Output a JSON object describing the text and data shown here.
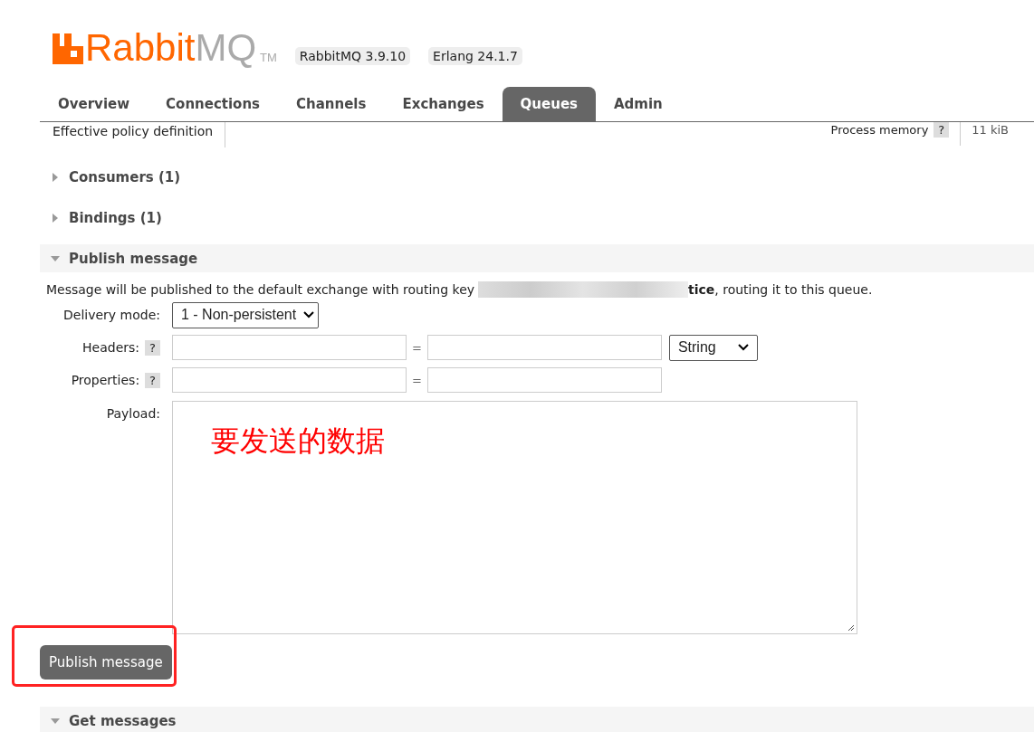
{
  "header": {
    "logo": {
      "brand": "Rabbit",
      "brand_suffix": "MQ",
      "trademark": "TM"
    },
    "versions": [
      "RabbitMQ 3.9.10",
      "Erlang 24.1.7"
    ]
  },
  "tabs": [
    {
      "label": "Overview",
      "selected": false
    },
    {
      "label": "Connections",
      "selected": false
    },
    {
      "label": "Channels",
      "selected": false
    },
    {
      "label": "Exchanges",
      "selected": false
    },
    {
      "label": "Queues",
      "selected": true
    },
    {
      "label": "Admin",
      "selected": false
    }
  ],
  "details_row": {
    "label": "Effective policy definition",
    "stat_label": "Process memory",
    "stat_help": "?",
    "stat_value": "11 kiB"
  },
  "sections": [
    {
      "title": "Consumers (1)",
      "expanded": false
    },
    {
      "title": "Bindings (1)",
      "expanded": false
    },
    {
      "title": "Publish message",
      "expanded": true
    }
  ],
  "publish": {
    "note_before": "Message will be published to the default exchange with routing key",
    "redacted": true,
    "note_after": "**tice**, routing it to this queue.",
    "delivery_mode": {
      "label": "Delivery mode:",
      "value": "1 - Non-persistent"
    },
    "headers": {
      "label": "Headers:",
      "help": "?",
      "equals": "=",
      "type": "String"
    },
    "properties": {
      "label": "Properties:",
      "help": "?",
      "equals": "="
    },
    "payload": {
      "label": "Payload:",
      "annotation": "要发送的数据"
    },
    "button": "Publish message",
    "button_highlighted": true
  },
  "bottom_section": {
    "title": "Get messages",
    "expanded": true
  }
}
